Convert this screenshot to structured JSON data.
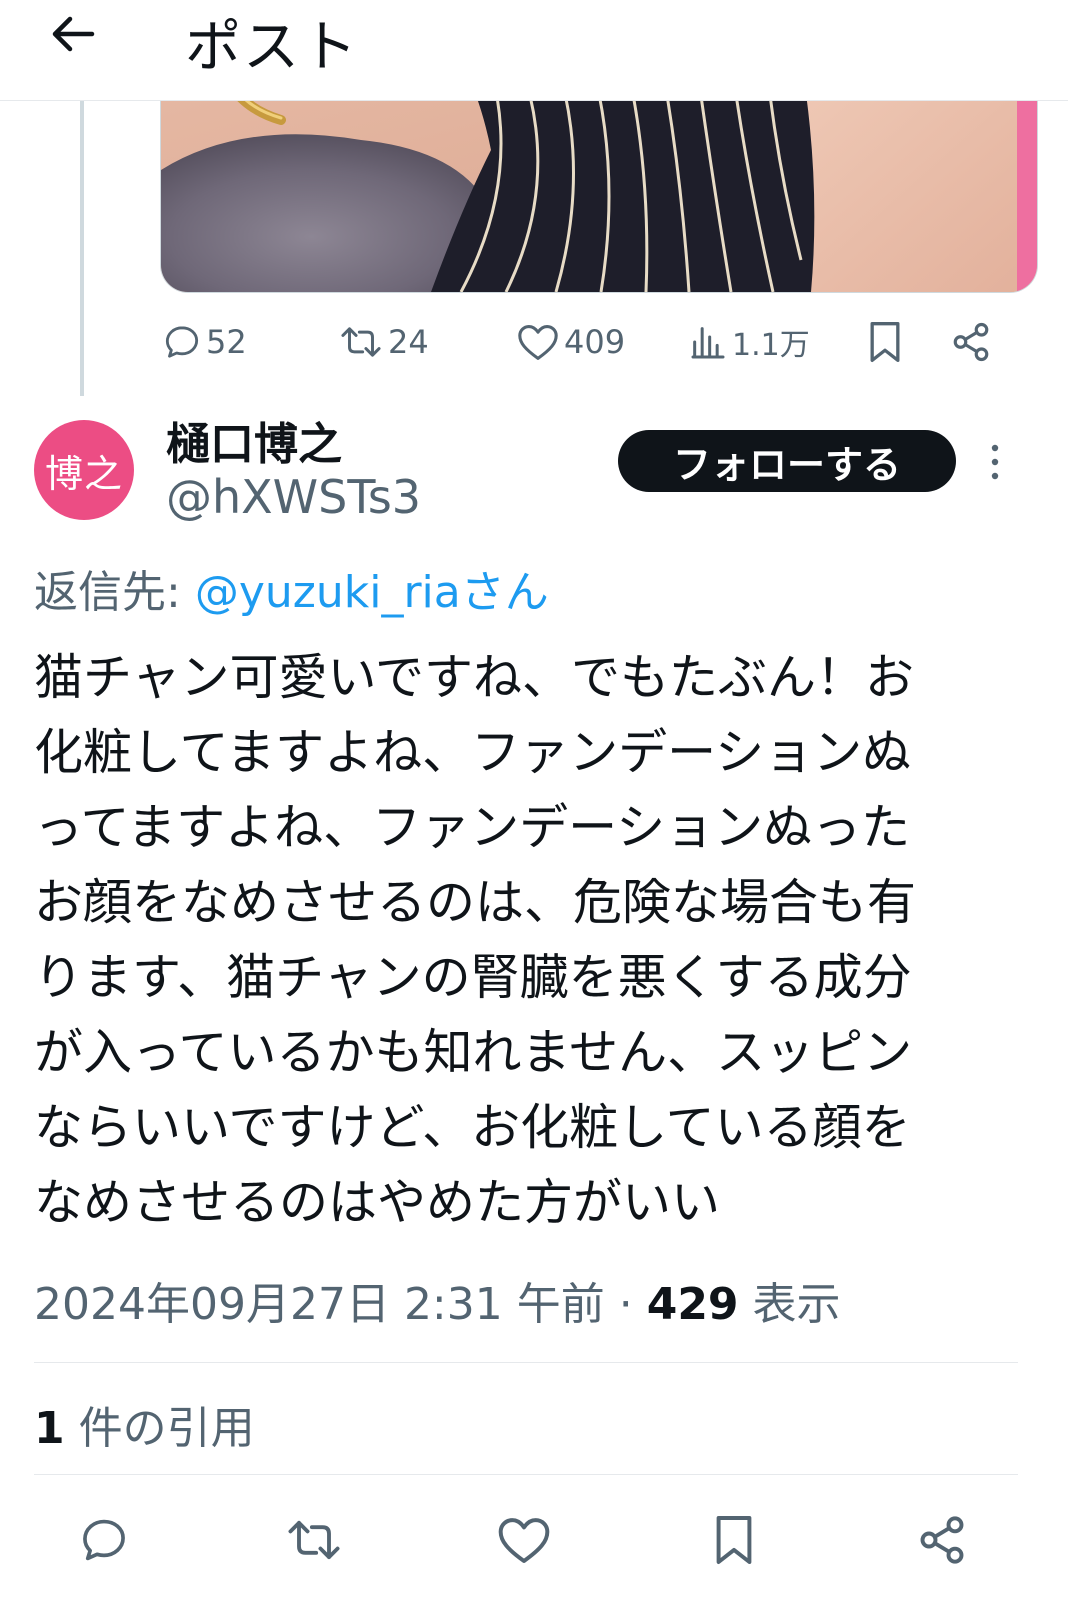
{
  "header": {
    "title": "ポスト",
    "back_icon": "arrow-left-icon"
  },
  "parent_post": {
    "stats": {
      "replies": "52",
      "reposts": "24",
      "likes": "409",
      "views": "1.1万"
    }
  },
  "reply": {
    "author": {
      "display_name": "樋口博之",
      "handle": "@hXWSTs3",
      "avatar_text": "博之",
      "avatar_color": "#ec4d84"
    },
    "follow_label": "フォローする",
    "reply_to_label": "返信先:",
    "reply_to_mention": "@yuzuki_riaさん",
    "text_lines": [
      "猫チャン可愛いですね、でもたぶん！お",
      "化粧してますよね、ファンデーションぬ",
      "ってますよね、ファンデーションぬった",
      "お顔をなめさせるのは、危険な場合も有",
      "ります、猫チャンの腎臓を悪くする成分",
      "が入っているかも知れません、スッピン",
      "ならいいですけど、お化粧している顔を",
      "なめさせるのはやめた方がいい"
    ],
    "timestamp": "2024年09月27日 2:31 午前",
    "separator": " · ",
    "views_count": "429",
    "views_label": " 表示",
    "quotes_count": "1",
    "quotes_label": " 件の引用"
  },
  "colors": {
    "accent": "#1d9bf0",
    "text_primary": "#0f1419",
    "text_secondary": "#536471",
    "border": "#cfd9de"
  }
}
